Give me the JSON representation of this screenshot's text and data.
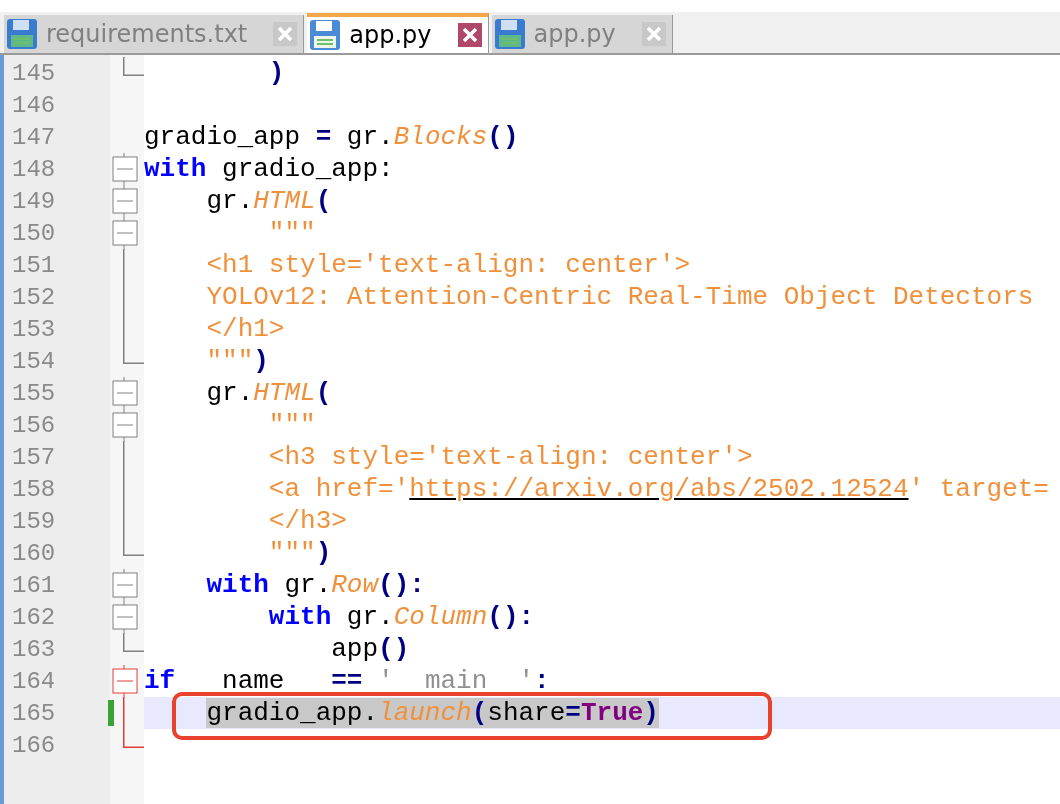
{
  "tabs": [
    {
      "label": "requirements.txt",
      "selected": false
    },
    {
      "label": "app.py",
      "selected": true
    },
    {
      "label": "app.py",
      "selected": false
    }
  ],
  "editor": {
    "lines": [
      {
        "number": "145",
        "fold": {
          "kind": "end",
          "red": false
        },
        "changed": false,
        "current": false,
        "tokens": [
          {
            "kind": "punct",
            "text": "        )"
          }
        ]
      },
      {
        "number": "146",
        "changed": false,
        "current": false
      },
      {
        "number": "147",
        "changed": false,
        "current": false,
        "tokens": [
          {
            "kind": "plain",
            "text": "gradio_app "
          },
          {
            "kind": "punct",
            "text": "="
          },
          {
            "kind": "plain",
            "text": " gr."
          },
          {
            "kind": "func",
            "text": "Blocks"
          },
          {
            "kind": "punct",
            "text": "()"
          }
        ]
      },
      {
        "number": "148",
        "fold": {
          "kind": "box",
          "red": false
        },
        "changed": false,
        "current": false,
        "tokens": [
          {
            "kind": "keyword",
            "text": "with"
          },
          {
            "kind": "plain",
            "text": " gradio_app:"
          }
        ]
      },
      {
        "number": "149",
        "fold": {
          "kind": "box",
          "red": false
        },
        "changed": false,
        "current": false,
        "tokens": [
          {
            "kind": "plain",
            "text": "    gr."
          },
          {
            "kind": "func",
            "text": "HTML"
          },
          {
            "kind": "punct",
            "text": "("
          }
        ]
      },
      {
        "number": "150",
        "fold": {
          "kind": "box",
          "red": false
        },
        "changed": false,
        "current": false,
        "tokens": [
          {
            "kind": "string",
            "text": "        \"\"\""
          }
        ]
      },
      {
        "number": "151",
        "fold": {
          "kind": "line",
          "red": false
        },
        "changed": false,
        "current": false,
        "tokens": [
          {
            "kind": "string",
            "text": "    <h1 style='text-align: center'>"
          }
        ]
      },
      {
        "number": "152",
        "fold": {
          "kind": "line",
          "red": false
        },
        "changed": false,
        "current": false,
        "tokens": [
          {
            "kind": "string",
            "text": "    YOLOv12: Attention-Centric Real-Time Object Detectors"
          }
        ]
      },
      {
        "number": "153",
        "fold": {
          "kind": "line",
          "red": false
        },
        "changed": false,
        "current": false,
        "tokens": [
          {
            "kind": "string",
            "text": "    </h1>"
          }
        ]
      },
      {
        "number": "154",
        "fold": {
          "kind": "end",
          "red": false
        },
        "changed": false,
        "current": false,
        "tokens": [
          {
            "kind": "string",
            "text": "    \"\"\""
          },
          {
            "kind": "punct",
            "text": ")"
          }
        ]
      },
      {
        "number": "155",
        "fold": {
          "kind": "box",
          "red": false
        },
        "changed": false,
        "current": false,
        "tokens": [
          {
            "kind": "plain",
            "text": "    gr."
          },
          {
            "kind": "func",
            "text": "HTML"
          },
          {
            "kind": "punct",
            "text": "("
          }
        ]
      },
      {
        "number": "156",
        "fold": {
          "kind": "box",
          "red": false
        },
        "changed": false,
        "current": false,
        "tokens": [
          {
            "kind": "string",
            "text": "        \"\"\""
          }
        ]
      },
      {
        "number": "157",
        "fold": {
          "kind": "line",
          "red": false
        },
        "changed": false,
        "current": false,
        "tokens": [
          {
            "kind": "string",
            "text": "        <h3 style='text-align: center'>"
          }
        ]
      },
      {
        "number": "158",
        "fold": {
          "kind": "line",
          "red": false
        },
        "changed": false,
        "current": false,
        "tokens": [
          {
            "kind": "string",
            "text": "        <a href='"
          },
          {
            "kind": "link",
            "text": "https://arxiv.org/abs/2502.12524"
          },
          {
            "kind": "string",
            "text": "' target="
          }
        ]
      },
      {
        "number": "159",
        "fold": {
          "kind": "line",
          "red": false
        },
        "changed": false,
        "current": false,
        "tokens": [
          {
            "kind": "string",
            "text": "        </h3>"
          }
        ]
      },
      {
        "number": "160",
        "fold": {
          "kind": "end",
          "red": false
        },
        "changed": false,
        "current": false,
        "tokens": [
          {
            "kind": "string",
            "text": "        \"\"\""
          },
          {
            "kind": "punct",
            "text": ")"
          }
        ]
      },
      {
        "number": "161",
        "fold": {
          "kind": "box",
          "red": false
        },
        "changed": false,
        "current": false,
        "tokens": [
          {
            "kind": "keyword",
            "text": "    with"
          },
          {
            "kind": "plain",
            "text": " gr."
          },
          {
            "kind": "func",
            "text": "Row"
          },
          {
            "kind": "punct",
            "text": "():"
          }
        ]
      },
      {
        "number": "162",
        "fold": {
          "kind": "box",
          "red": false
        },
        "changed": false,
        "current": false,
        "tokens": [
          {
            "kind": "keyword",
            "text": "        with"
          },
          {
            "kind": "plain",
            "text": " gr."
          },
          {
            "kind": "func",
            "text": "Column"
          },
          {
            "kind": "punct",
            "text": "():"
          }
        ]
      },
      {
        "number": "163",
        "fold": {
          "kind": "end",
          "red": false
        },
        "changed": false,
        "current": false,
        "tokens": [
          {
            "kind": "plain",
            "text": "            app"
          },
          {
            "kind": "punct",
            "text": "()"
          }
        ]
      },
      {
        "number": "164",
        "fold": {
          "kind": "box",
          "red": true
        },
        "changed": false,
        "current": false,
        "tokens": [
          {
            "kind": "keyword",
            "text": "if"
          },
          {
            "kind": "plain",
            "text": "   name   "
          },
          {
            "kind": "punct",
            "text": "=="
          },
          {
            "kind": "dunder",
            "text": " '  main  '"
          },
          {
            "kind": "punct",
            "text": ":"
          }
        ]
      },
      {
        "number": "165",
        "fold": {
          "kind": "line",
          "red": true
        },
        "changed": true,
        "current": true,
        "tokens": [
          {
            "kind": "plain",
            "text": "    gradio_app.",
            "selected": true
          },
          {
            "kind": "func",
            "text": "launch",
            "selected": true
          },
          {
            "kind": "punct",
            "text": "(",
            "selected": true
          },
          {
            "kind": "plain",
            "text": "share",
            "selected": true
          },
          {
            "kind": "punct",
            "text": "=",
            "selected": true
          },
          {
            "kind": "builtin",
            "text": "True",
            "selected": true
          },
          {
            "kind": "punct",
            "text": ")",
            "selected": true
          }
        ]
      },
      {
        "number": "166",
        "fold": {
          "kind": "end",
          "red": true
        },
        "changed": false,
        "current": false
      }
    ]
  }
}
